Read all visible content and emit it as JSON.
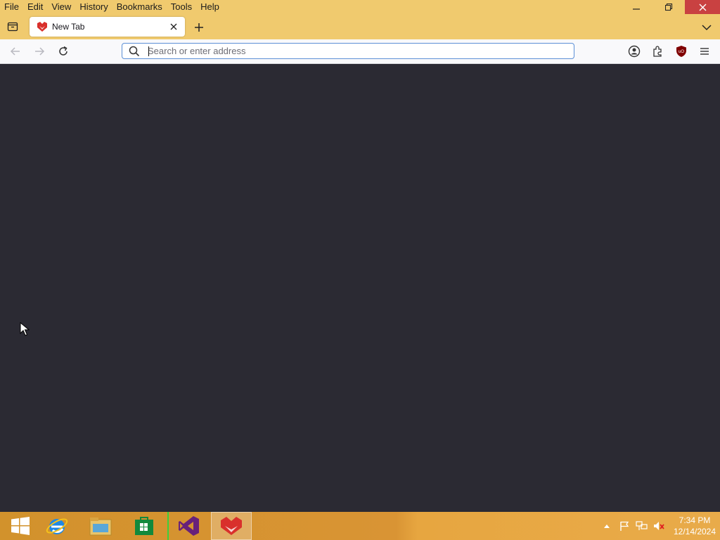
{
  "menubar": {
    "items": [
      "File",
      "Edit",
      "View",
      "History",
      "Bookmarks",
      "Tools",
      "Help"
    ]
  },
  "window_controls": {
    "minimize": "–",
    "restore": "❐",
    "close": "✕"
  },
  "tabs": [
    {
      "title": "New Tab",
      "active": true
    }
  ],
  "urlbar": {
    "value": "",
    "placeholder": "Search or enter address"
  },
  "taskbar": {
    "apps": [
      "start-button",
      "internet-explorer",
      "file-explorer",
      "windows-store",
      "visual-studio",
      "browser"
    ],
    "clock_time": "7:34 PM",
    "clock_date": "12/14/2024"
  },
  "colors": {
    "titlebar": "#f0ca6e",
    "content_bg": "#2b2a33",
    "urlbar_border": "#5b8fd6",
    "close_button": "#c94141"
  }
}
